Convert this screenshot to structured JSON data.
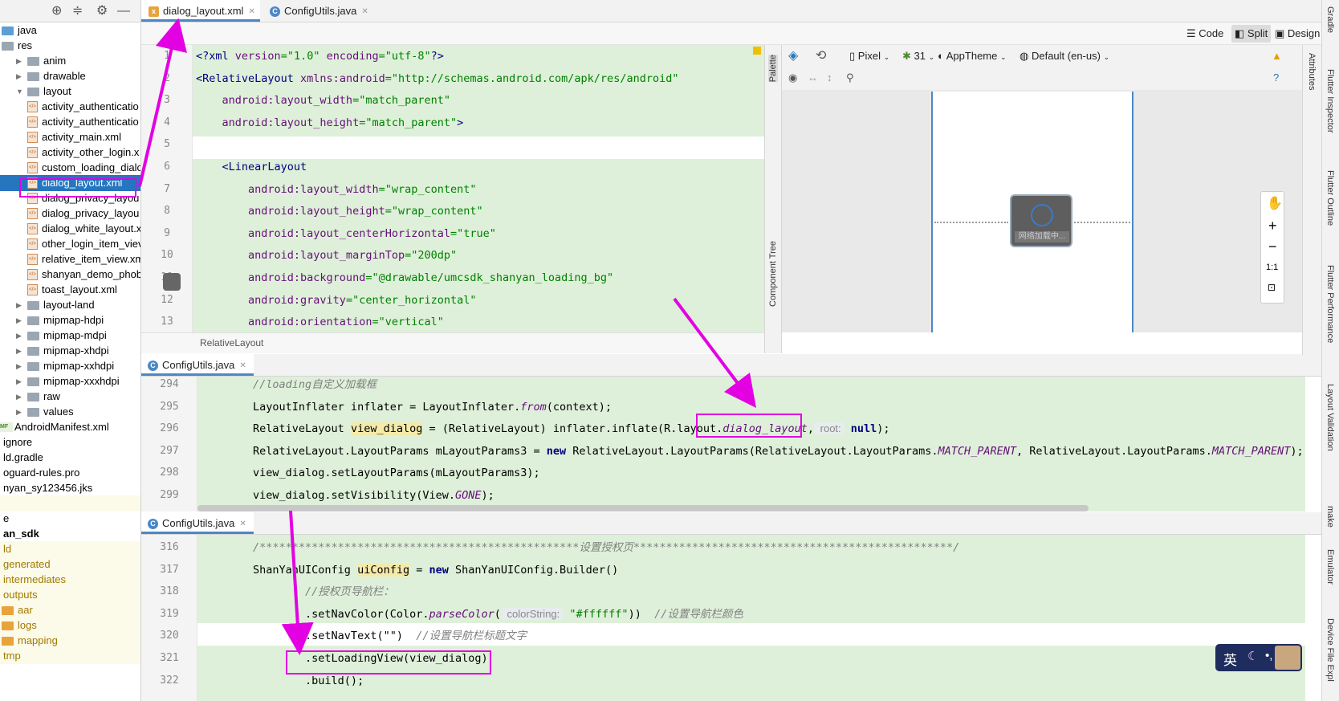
{
  "project_tree": {
    "items": [
      {
        "label": "java",
        "icon": "folder-blue-icon",
        "indent": 0,
        "arrow": false
      },
      {
        "label": "res",
        "icon": "folder-icon",
        "indent": 0,
        "arrow": false
      },
      {
        "label": "anim",
        "icon": "folder-icon",
        "indent": 1,
        "arrow": "right"
      },
      {
        "label": "drawable",
        "icon": "folder-icon",
        "indent": 1,
        "arrow": "right"
      },
      {
        "label": "layout",
        "icon": "folder-icon",
        "indent": 1,
        "arrow": "down"
      },
      {
        "label": "activity_authenticatio",
        "icon": "xml-icon",
        "indent": 2
      },
      {
        "label": "activity_authenticatio",
        "icon": "xml-icon",
        "indent": 2
      },
      {
        "label": "activity_main.xml",
        "icon": "xml-icon",
        "indent": 2
      },
      {
        "label": "activity_other_login.x",
        "icon": "xml-icon",
        "indent": 2
      },
      {
        "label": "custom_loading_dialo",
        "icon": "xml-icon",
        "indent": 2
      },
      {
        "label": "dialog_layout.xml",
        "icon": "xml-icon",
        "indent": 2,
        "selected": true
      },
      {
        "label": "dialog_privacy_layou",
        "icon": "xml-icon",
        "indent": 2
      },
      {
        "label": "dialog_privacy_layou",
        "icon": "xml-icon",
        "indent": 2
      },
      {
        "label": "dialog_white_layout.x",
        "icon": "xml-icon",
        "indent": 2
      },
      {
        "label": "other_login_item_viev",
        "icon": "xml-icon",
        "indent": 2
      },
      {
        "label": "relative_item_view.xm",
        "icon": "xml-icon",
        "indent": 2
      },
      {
        "label": "shanyan_demo_phob",
        "icon": "xml-icon",
        "indent": 2
      },
      {
        "label": "toast_layout.xml",
        "icon": "xml-icon",
        "indent": 2
      },
      {
        "label": "layout-land",
        "icon": "folder-icon",
        "indent": 1,
        "arrow": "right"
      },
      {
        "label": "mipmap-hdpi",
        "icon": "folder-icon",
        "indent": 1,
        "arrow": "right"
      },
      {
        "label": "mipmap-mdpi",
        "icon": "folder-icon",
        "indent": 1,
        "arrow": "right"
      },
      {
        "label": "mipmap-xhdpi",
        "icon": "folder-icon",
        "indent": 1,
        "arrow": "right"
      },
      {
        "label": "mipmap-xxhdpi",
        "icon": "folder-icon",
        "indent": 1,
        "arrow": "right"
      },
      {
        "label": "mipmap-xxxhdpi",
        "icon": "folder-icon",
        "indent": 1,
        "arrow": "right"
      },
      {
        "label": "raw",
        "icon": "folder-icon",
        "indent": 1,
        "arrow": "right"
      },
      {
        "label": "values",
        "icon": "folder-icon",
        "indent": 1,
        "arrow": "right"
      },
      {
        "label": "AndroidManifest.xml",
        "icon": "manifest-icon",
        "indent": 0
      },
      {
        "label": "ignore",
        "icon": "none",
        "indent": -1
      },
      {
        "label": "ld.gradle",
        "icon": "none",
        "indent": -1
      },
      {
        "label": "oguard-rules.pro",
        "icon": "none",
        "indent": -1
      },
      {
        "label": "nyan_sy123456.jks",
        "icon": "none",
        "indent": -1
      },
      {
        "label": "",
        "icon": "none",
        "indent": -1,
        "yellow": true
      },
      {
        "label": "e",
        "icon": "none",
        "indent": -1
      },
      {
        "label": "an_sdk",
        "icon": "none",
        "indent": -1,
        "bold": true
      },
      {
        "label": "ld",
        "icon": "none",
        "indent": -1,
        "yellow": true
      },
      {
        "label": "generated",
        "icon": "none",
        "indent": -1,
        "yellow": true
      },
      {
        "label": "intermediates",
        "icon": "none",
        "indent": -1,
        "yellow": true
      },
      {
        "label": "outputs",
        "icon": "none",
        "indent": -1,
        "yellow": true
      },
      {
        "label": "aar",
        "icon": "folder-orange-icon",
        "indent": 0,
        "yellow": true
      },
      {
        "label": "logs",
        "icon": "folder-orange-icon",
        "indent": 0,
        "yellow": true
      },
      {
        "label": "mapping",
        "icon": "folder-orange-icon",
        "indent": 0,
        "yellow": true
      },
      {
        "label": "tmp",
        "icon": "none",
        "indent": -1,
        "yellow": true
      }
    ]
  },
  "tabs_top": [
    {
      "label": "dialog_layout.xml",
      "active": true,
      "icon": "xml-icon"
    },
    {
      "label": "ConfigUtils.java",
      "active": false,
      "icon": "class-icon"
    }
  ],
  "view_modes": {
    "code": "Code",
    "split": "Split",
    "design": "Design"
  },
  "design_toolbar": {
    "device": "Pixel",
    "api": "31",
    "theme": "AppTheme",
    "locale": "Default (en-us)"
  },
  "palette_label": "Palette",
  "component_tree_label": "Component Tree",
  "breadcrumb": "RelativeLayout",
  "preview_loading_text": "网络加载中...",
  "zoom": {
    "fit": "1:1"
  },
  "xml_pane": {
    "line_numbers": [
      "1",
      "2",
      "3",
      "4",
      "5",
      "6",
      "7",
      "8",
      "9",
      "10",
      "11",
      "12",
      "13"
    ],
    "lines": [
      [
        {
          "t": "<?xml ",
          "c": "tag"
        },
        {
          "t": "version",
          "c": "attr"
        },
        {
          "t": "=\"1.0\" ",
          "c": "val"
        },
        {
          "t": "encoding",
          "c": "attr"
        },
        {
          "t": "=\"utf-8\"",
          "c": "val"
        },
        {
          "t": "?>",
          "c": "tag"
        }
      ],
      [
        {
          "t": "<RelativeLayout ",
          "c": "tag"
        },
        {
          "t": "xmlns:android",
          "c": "attr"
        },
        {
          "t": "=\"http://schemas.android.com/apk/res/android\"",
          "c": "val"
        }
      ],
      [
        {
          "t": "    android:layout_width",
          "c": "attr"
        },
        {
          "t": "=\"match_parent\"",
          "c": "val"
        }
      ],
      [
        {
          "t": "    android:layout_height",
          "c": "attr"
        },
        {
          "t": "=\"match_parent\"",
          "c": "val"
        },
        {
          "t": ">",
          "c": "tag"
        }
      ],
      [],
      [
        {
          "t": "    <LinearLayout",
          "c": "tag"
        }
      ],
      [
        {
          "t": "        android:layout_width",
          "c": "attr"
        },
        {
          "t": "=\"wrap_content\"",
          "c": "val"
        }
      ],
      [
        {
          "t": "        android:layout_height",
          "c": "attr"
        },
        {
          "t": "=\"wrap_content\"",
          "c": "val"
        }
      ],
      [
        {
          "t": "        android:layout_centerHorizontal",
          "c": "attr"
        },
        {
          "t": "=\"true\"",
          "c": "val"
        }
      ],
      [
        {
          "t": "        android:layout_marginTop",
          "c": "attr"
        },
        {
          "t": "=\"200dp\"",
          "c": "val"
        }
      ],
      [
        {
          "t": "        android:background",
          "c": "attr"
        },
        {
          "t": "=\"@drawable/umcsdk_shanyan_loading_bg\"",
          "c": "val"
        }
      ],
      [
        {
          "t": "        android:gravity",
          "c": "attr"
        },
        {
          "t": "=\"center_horizontal\"",
          "c": "val"
        }
      ],
      [
        {
          "t": "        android:orientation",
          "c": "attr"
        },
        {
          "t": "=\"vertical\"",
          "c": "val"
        }
      ]
    ]
  },
  "tab_mid": {
    "label": "ConfigUtils.java"
  },
  "java_pane_1": {
    "line_numbers": [
      "294",
      "295",
      "296",
      "297",
      "298",
      "299"
    ],
    "lines": [
      [
        {
          "t": "        //loading自定义加载框",
          "c": "cm"
        }
      ],
      [
        {
          "t": "        LayoutInflater inflater = LayoutInflater.",
          "c": ""
        },
        {
          "t": "from",
          "c": "fld"
        },
        {
          "t": "(context);",
          "c": ""
        }
      ],
      [
        {
          "t": "        RelativeLayout ",
          "c": ""
        },
        {
          "t": "view_dialog",
          "c": "hlbg"
        },
        {
          "t": " = (RelativeLayout) inflater.inflate(R.layout.",
          "c": ""
        },
        {
          "t": "dialog_layout",
          "c": "fld"
        },
        {
          "t": ",",
          "c": ""
        },
        {
          "t": " root:",
          "c": "hint"
        },
        {
          "t": " null",
          "c": "kw"
        },
        {
          "t": ");",
          "c": ""
        }
      ],
      [
        {
          "t": "        RelativeLayout.LayoutParams mLayoutParams3 = ",
          "c": ""
        },
        {
          "t": "new",
          "c": "kw"
        },
        {
          "t": " RelativeLayout.LayoutParams(RelativeLayout.LayoutParams.",
          "c": ""
        },
        {
          "t": "MATCH_PARENT",
          "c": "fld"
        },
        {
          "t": ", RelativeLayout.LayoutParams.",
          "c": ""
        },
        {
          "t": "MATCH_PARENT",
          "c": "fld"
        },
        {
          "t": ");",
          "c": ""
        }
      ],
      [
        {
          "t": "        view_dialog.setLayoutParams(mLayoutParams3);",
          "c": ""
        }
      ],
      [
        {
          "t": "        view_dialog.setVisibility(View.",
          "c": ""
        },
        {
          "t": "GONE",
          "c": "fld"
        },
        {
          "t": ");",
          "c": ""
        }
      ]
    ]
  },
  "tab_bottom": {
    "label": "ConfigUtils.java"
  },
  "java_pane_2": {
    "line_numbers": [
      "316",
      "317",
      "318",
      "319",
      "320",
      "321",
      "322"
    ],
    "lines": [
      [
        {
          "t": "        /*************************************************设置授权页*************************************************/",
          "c": "cm"
        }
      ],
      [
        {
          "t": "        ShanYanUIConfig ",
          "c": ""
        },
        {
          "t": "uiConfig",
          "c": "hlbg"
        },
        {
          "t": " = ",
          "c": ""
        },
        {
          "t": "new",
          "c": "kw"
        },
        {
          "t": " ShanYanUIConfig.Builder()",
          "c": ""
        }
      ],
      [
        {
          "t": "                //授权页导航栏：",
          "c": "cm"
        }
      ],
      [
        {
          "t": "                .setNavColor(Color.",
          "c": ""
        },
        {
          "t": "parseColor",
          "c": "fld"
        },
        {
          "t": "(",
          "c": ""
        },
        {
          "t": " colorString:",
          "c": "hint"
        },
        {
          "t": " \"#ffffff\"",
          "c": "val"
        },
        {
          "t": "))  ",
          "c": ""
        },
        {
          "t": "//设置导航栏颜色",
          "c": "cm"
        }
      ],
      [
        {
          "t": "                .setNavText(\"\")  ",
          "c": ""
        },
        {
          "t": "//设置导航栏标题文字",
          "c": "cm"
        }
      ],
      [
        {
          "t": "                .setLoadingView(view_dialog)",
          "c": ""
        }
      ],
      [
        {
          "t": "                .build();",
          "c": ""
        }
      ]
    ]
  },
  "right_strip": {
    "gradle": "Gradle",
    "flutter_inspector": "Flutter Inspector",
    "flutter_outline": "Flutter Outline",
    "flutter_performance": "Flutter Performance",
    "layout_validation": "Layout Validation",
    "make": "make",
    "emulator": "Emulator",
    "device_file": "Device File Expl",
    "attributes": "Attributes"
  },
  "ime": {
    "label": "英"
  },
  "colors": {
    "accent": "#e300e3",
    "selection": "#2675bf",
    "code_bg": "#def0d9"
  }
}
